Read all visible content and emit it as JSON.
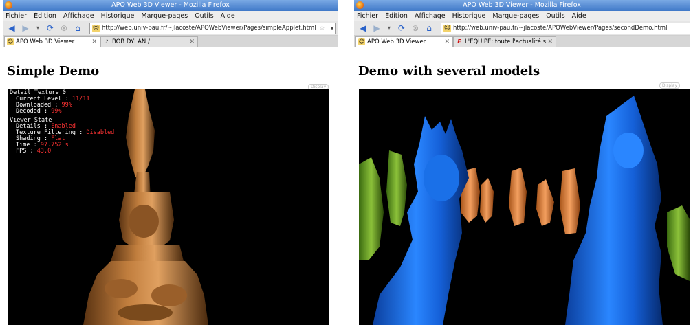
{
  "left": {
    "title": "APO Web 3D Viewer - Mozilla Firefox",
    "menu": [
      "Fichier",
      "Édition",
      "Affichage",
      "Historique",
      "Marque-pages",
      "Outils",
      "Aide"
    ],
    "url": "http://web.univ-pau.fr/~jlacoste/APOWebViewer/Pages/simpleApplet.html",
    "tabs": [
      {
        "label": "APO Web 3D Viewer",
        "icon": "page-icon"
      },
      {
        "label": "BOB DYLAN /",
        "icon": "music-note-icon"
      }
    ],
    "heading": "Simple Demo",
    "badge": "Display",
    "hud": {
      "texture_title": "Detail Texture 0",
      "current_level_label": "Current Level :",
      "current_level": "11/11",
      "downloaded_label": "Downloaded :",
      "downloaded": "99%",
      "decoded_label": "Decoded :",
      "decoded": "99%",
      "viewer_title": "Viewer State",
      "details_label": "Details :",
      "details": "Enabled",
      "filtering_label": "Texture Filtering :",
      "filtering": "Disabled",
      "shading_label": "Shading :",
      "shading": "Flat",
      "time_label": "Time :",
      "time": "97.752 s",
      "fps_label": "FPS :",
      "fps": "43.0"
    }
  },
  "right": {
    "title": "APO Web 3D Viewer - Mozilla Firefox",
    "menu": [
      "Fichier",
      "Édition",
      "Affichage",
      "Historique",
      "Marque-pages",
      "Outils",
      "Aide"
    ],
    "url": "http://web.univ-pau.fr/~jlacoste/APOWebViewer/Pages/secondDemo.html",
    "tabs": [
      {
        "label": "APO Web 3D Viewer",
        "icon": "page-icon"
      },
      {
        "label": "L'EQUIPE: toute l'actualité s...",
        "icon": "lequipe-icon"
      }
    ],
    "heading": "Demo with several models",
    "badge": "Display"
  },
  "colors": {
    "titlebar": "#3f78c8",
    "bronze": "#b07238",
    "blue_statue": "#1a6fe0",
    "hud_value": "#ff3333"
  }
}
